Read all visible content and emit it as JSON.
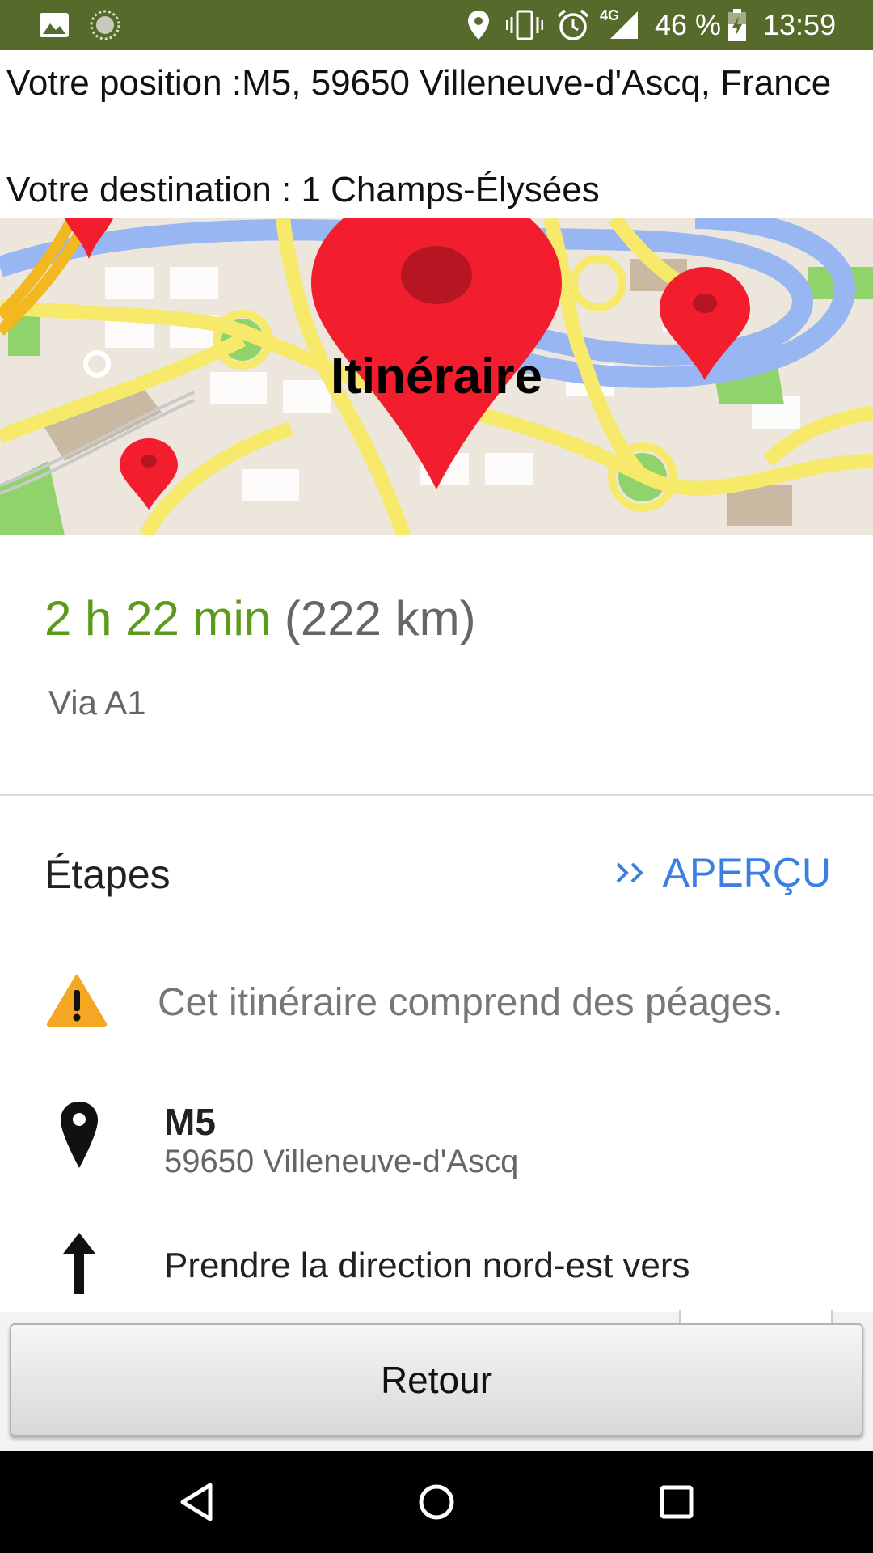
{
  "status_bar": {
    "network": "4G",
    "battery": "46 %",
    "time": "13:59",
    "icons": [
      "image-icon",
      "circle-notification-icon",
      "location-icon",
      "vibrate-icon",
      "alarm-icon",
      "signal-icon",
      "battery-icon"
    ]
  },
  "header": {
    "position": "Votre position :M5, 59650 Villeneuve-d'Ascq, France",
    "destination": "Votre destination : 1 Champs-Élysées"
  },
  "map": {
    "label": "Itinéraire"
  },
  "route": {
    "duration": "2 h 22 min",
    "distance": "(222 km)",
    "via": "Via A1"
  },
  "steps": {
    "title": "Étapes",
    "apercu": "APERÇU",
    "warning": "Cet itinéraire comprend des péages.",
    "start_title": "M5",
    "start_sub": "59650 Villeneuve-d'Ascq",
    "direction": "Prendre la direction nord-est vers"
  },
  "button": {
    "retour": "Retour"
  },
  "colors": {
    "status_bar": "#566b2b",
    "duration_green": "#5c9a1b",
    "link_blue": "#3b7fe0",
    "warning_orange": "#f5a623"
  }
}
